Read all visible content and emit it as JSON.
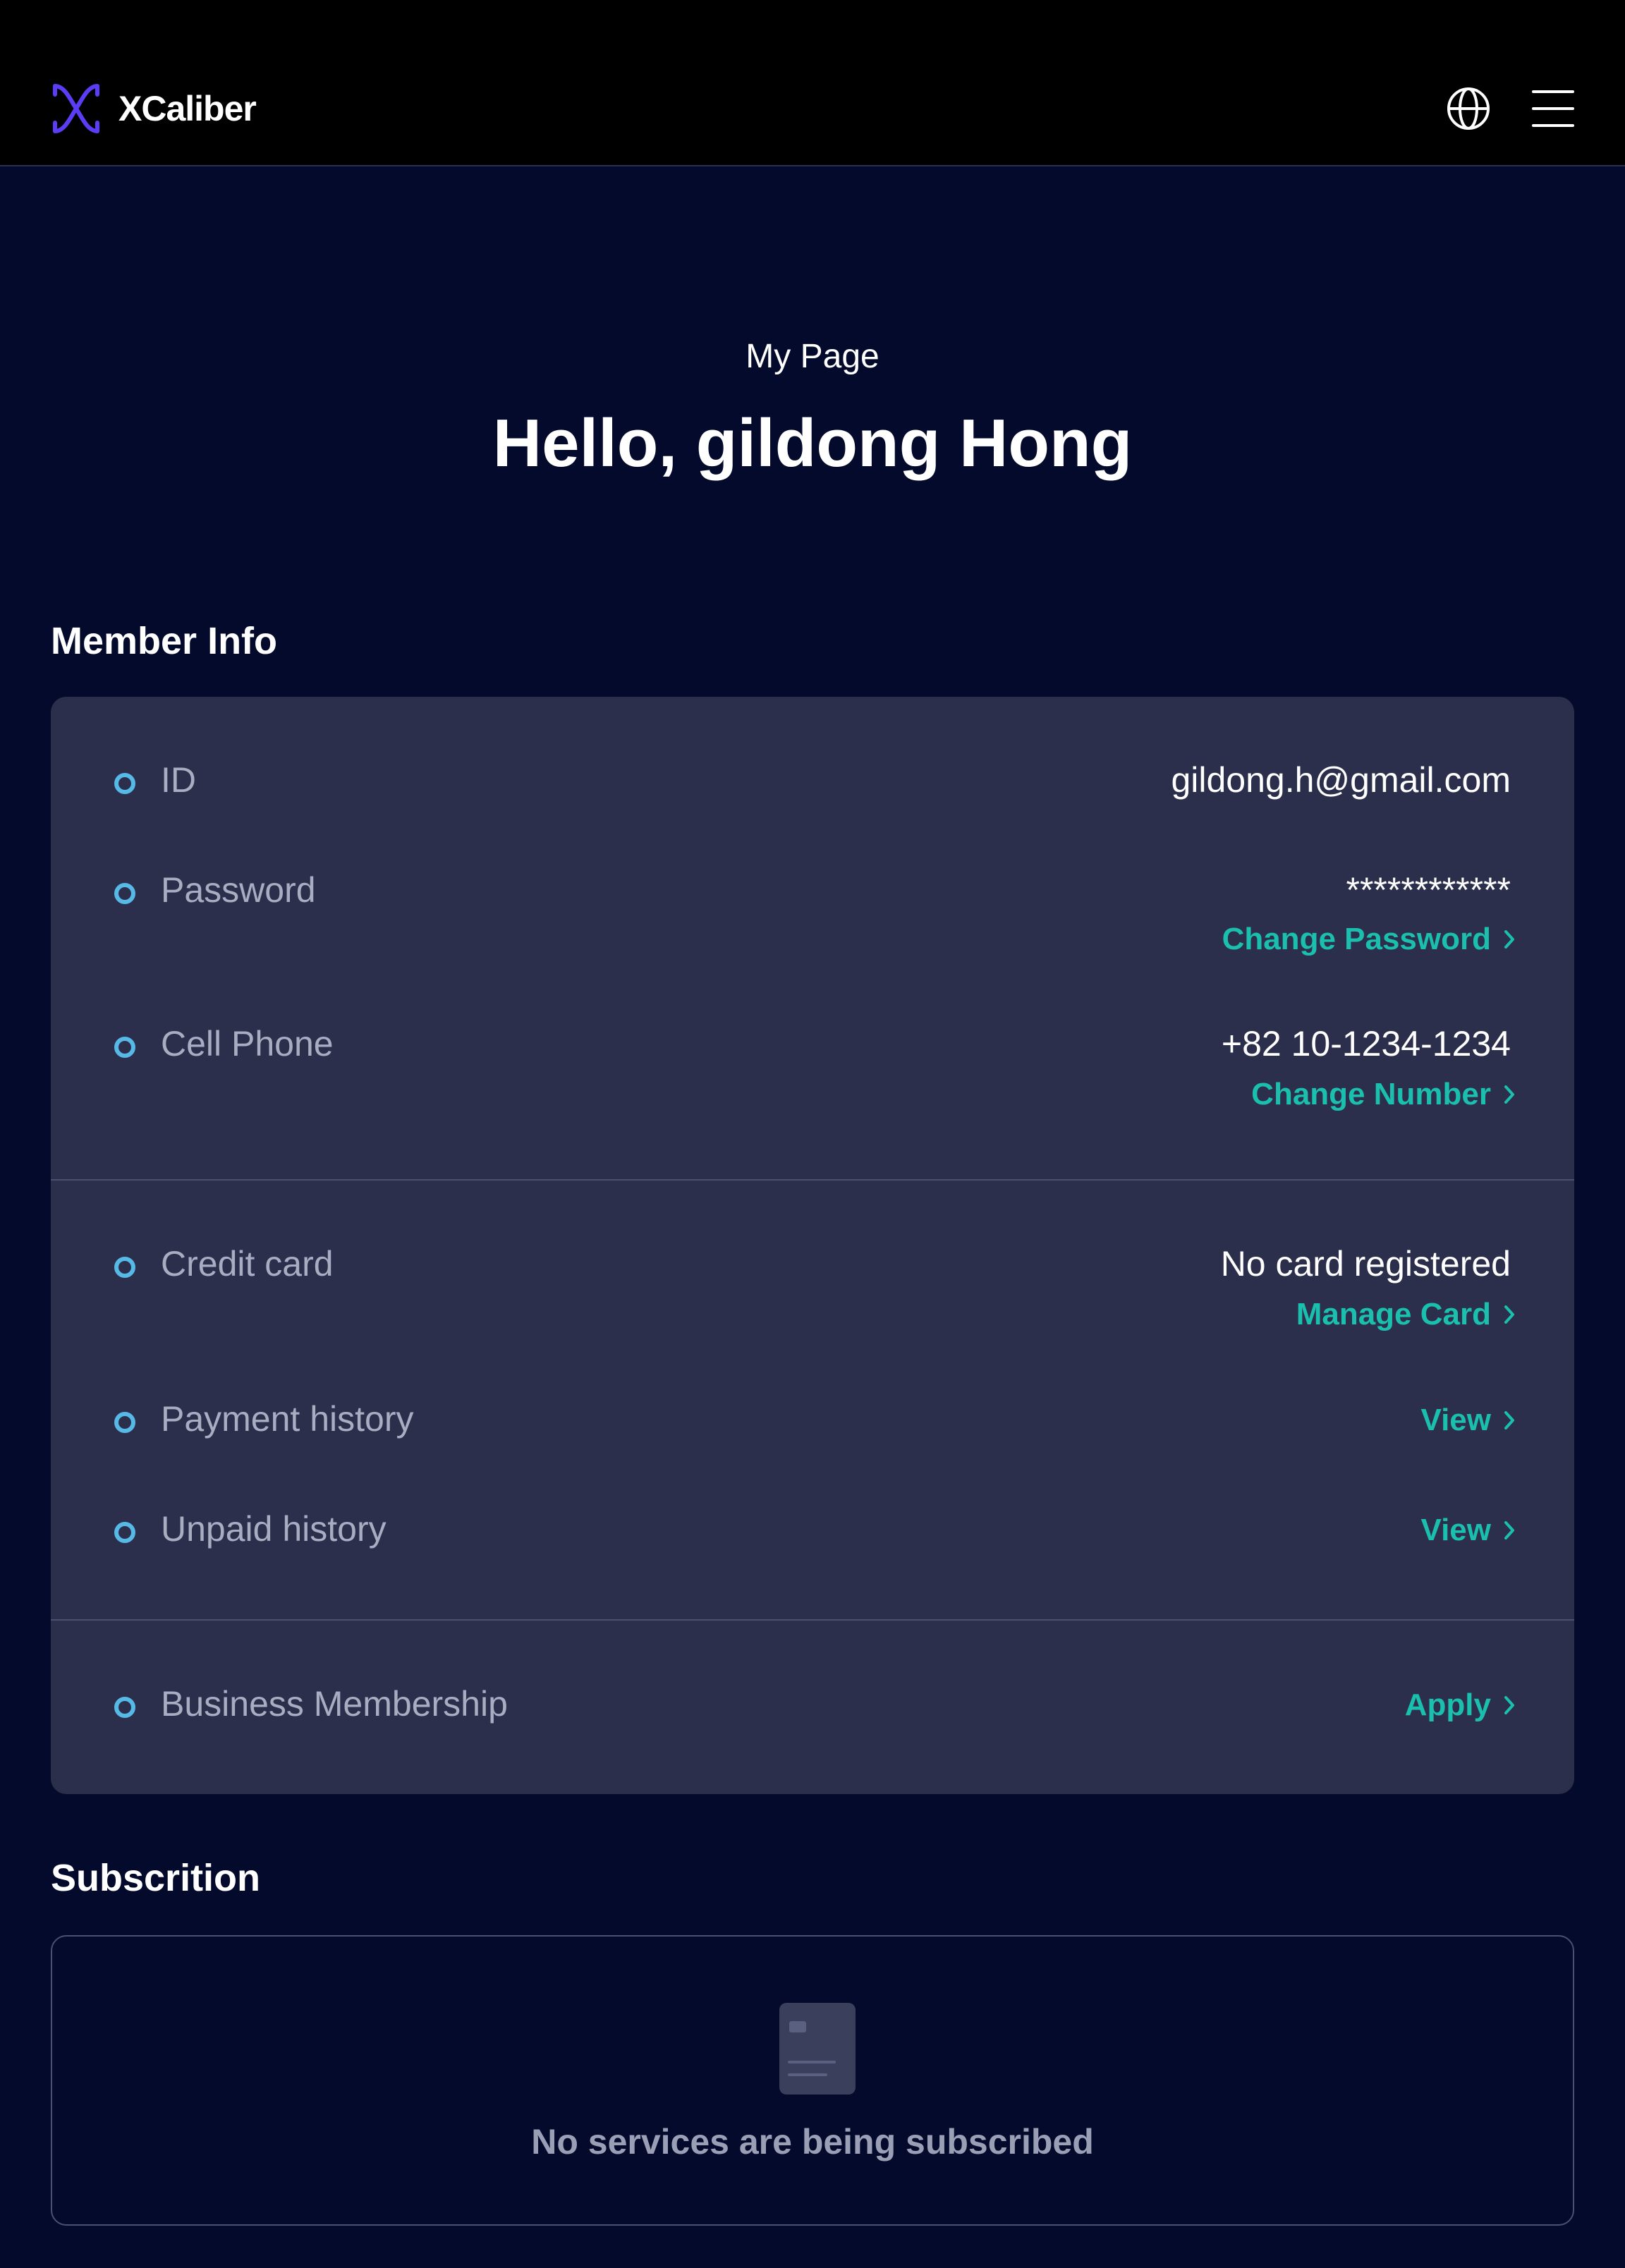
{
  "header": {
    "logo_text": "XCaliber",
    "globe_icon": "globe-icon",
    "menu_icon": "hamburger-menu-icon"
  },
  "page": {
    "subtitle": "My Page",
    "greeting": "Hello, gildong Hong"
  },
  "member_info": {
    "title": "Member Info",
    "id": {
      "label": "ID",
      "value": "gildong.h@gmail.com"
    },
    "password": {
      "label": "Password",
      "value": "************",
      "link": "Change Password"
    },
    "cell_phone": {
      "label": "Cell Phone",
      "value": "+82 10-1234-1234",
      "link": "Change Number"
    },
    "credit_card": {
      "label": "Credit card",
      "value": "No card registered",
      "link": "Manage Card"
    },
    "payment_history": {
      "label": "Payment history",
      "link": "View"
    },
    "unpaid_history": {
      "label": "Unpaid history",
      "link": "View"
    },
    "business_membership": {
      "label": "Business Membership",
      "link": "Apply"
    }
  },
  "subscription": {
    "title": "Subscrition",
    "empty_text": "No services are being subscribed",
    "empty_icon": "document-icon"
  },
  "colors": {
    "background": "#030a2c",
    "header": "#000000",
    "card": "#2b2f4c",
    "accent_link": "#1bbfae",
    "bullet": "#56b9e6",
    "logo": "#6a4cff"
  }
}
